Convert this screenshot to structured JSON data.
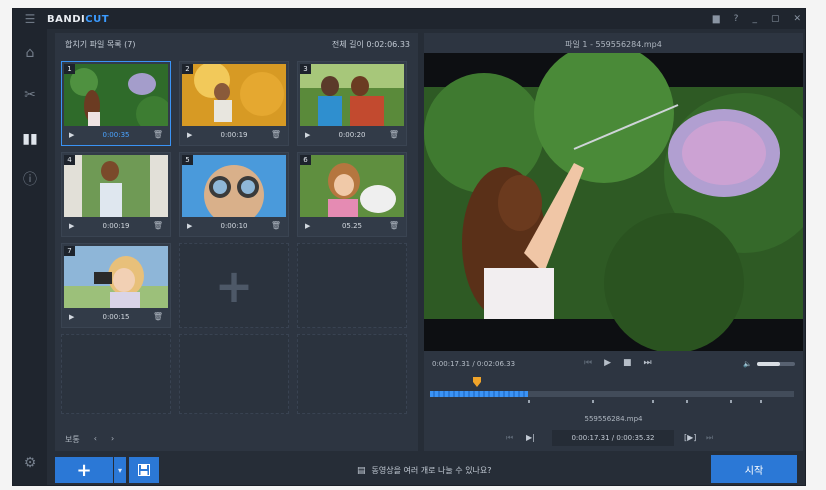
{
  "app": {
    "logo_main": "BANDI",
    "logo_accent": "CUT"
  },
  "titlebar": {
    "icons": [
      "folder-icon",
      "help-icon",
      "minimize-icon",
      "maximize-icon",
      "close-icon"
    ]
  },
  "sidebar": {
    "items": [
      "home-icon",
      "cut-icon",
      "join-icon",
      "info-icon",
      "settings-icon"
    ]
  },
  "left_panel": {
    "title": "합치기 파일 목록 (7)",
    "total": "전체 길이 0:02:06.33",
    "clips": [
      {
        "num": "1",
        "time": "0:00:35",
        "scene": "bubble-girl"
      },
      {
        "num": "2",
        "time": "0:00:19",
        "scene": "splash-kid"
      },
      {
        "num": "3",
        "time": "0:00:20",
        "scene": "kids-sofa"
      },
      {
        "num": "4",
        "time": "0:00:19",
        "scene": "girl-frame"
      },
      {
        "num": "5",
        "time": "0:00:10",
        "scene": "sunglasses"
      },
      {
        "num": "6",
        "time": "05.25",
        "scene": "girl-rabbit"
      },
      {
        "num": "7",
        "time": "0:00:15",
        "scene": "camera-girl"
      }
    ],
    "footer_label": "보통"
  },
  "preview": {
    "title": "파일 1 - 559556284.mp4",
    "time": "0:00:17.31 / 0:02:06.33",
    "volume_level": 0.6,
    "timeline_progress": 0.27,
    "timeline_marker": 0.13,
    "filename": "559556284.mp4",
    "segment_time": "0:00:17.31 / 0:00:35.32"
  },
  "bottom": {
    "add_label": "+",
    "help_text": "동영상을 여러 개로 나눌 수 있나요?",
    "start_label": "시작"
  }
}
